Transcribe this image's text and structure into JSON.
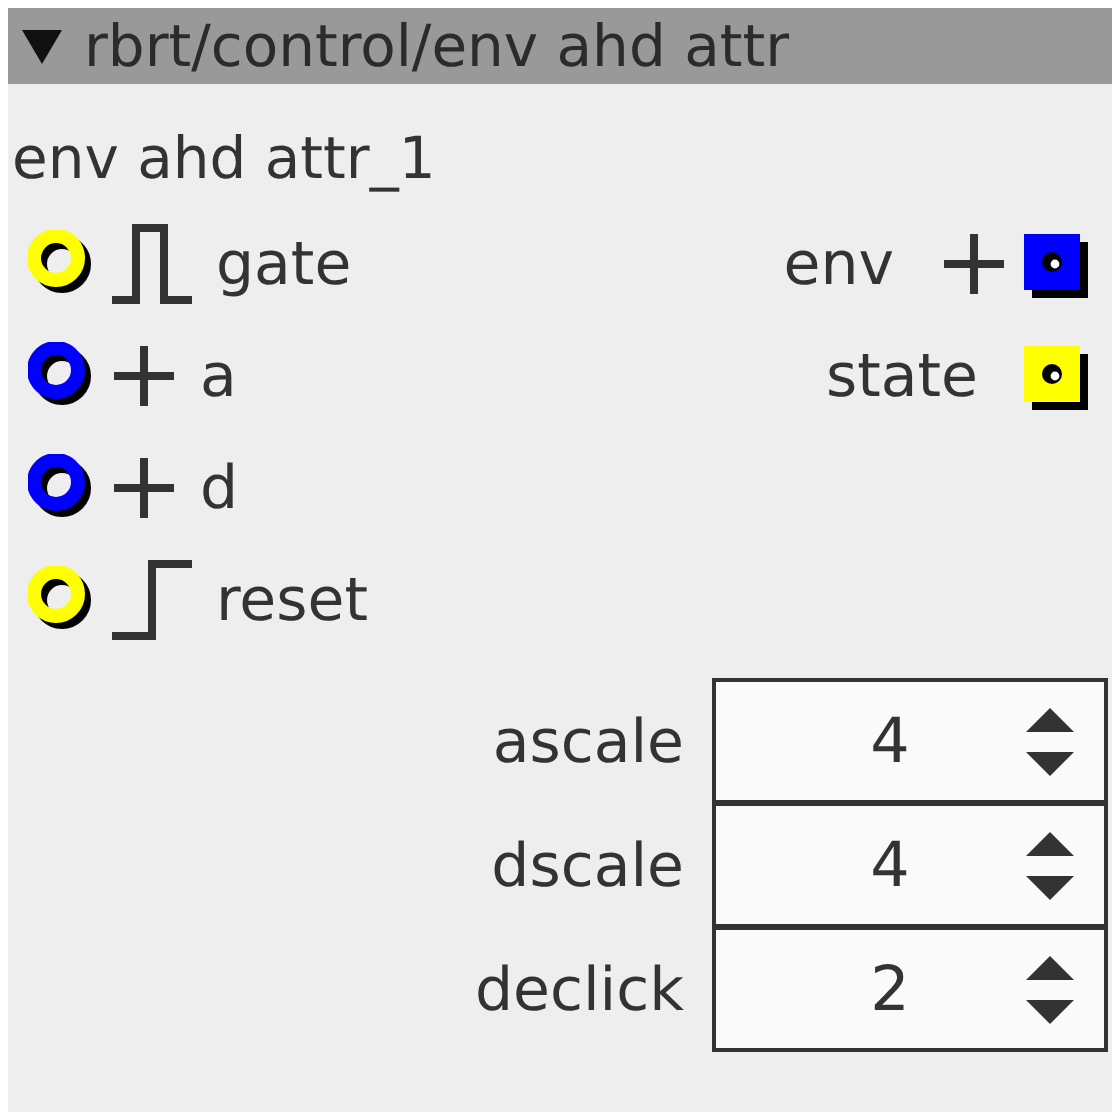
{
  "node": {
    "title": "rbrt/control/env ahd attr",
    "expanded": true,
    "name": "env ahd attr_1",
    "inputs": [
      {
        "label": "gate",
        "kind": "gate",
        "color": "#ffff00"
      },
      {
        "label": "a",
        "kind": "value",
        "color": "#0000ff"
      },
      {
        "label": "d",
        "kind": "value",
        "color": "#0000ff"
      },
      {
        "label": "reset",
        "kind": "trigger",
        "color": "#ffff00"
      }
    ],
    "outputs": [
      {
        "label": "env",
        "kind": "value",
        "color": "#0000ff"
      },
      {
        "label": "state",
        "kind": "plain",
        "color": "#ffff00"
      }
    ],
    "params": [
      {
        "label": "ascale",
        "value": "4"
      },
      {
        "label": "dscale",
        "value": "4"
      },
      {
        "label": "declick",
        "value": "2"
      }
    ]
  }
}
